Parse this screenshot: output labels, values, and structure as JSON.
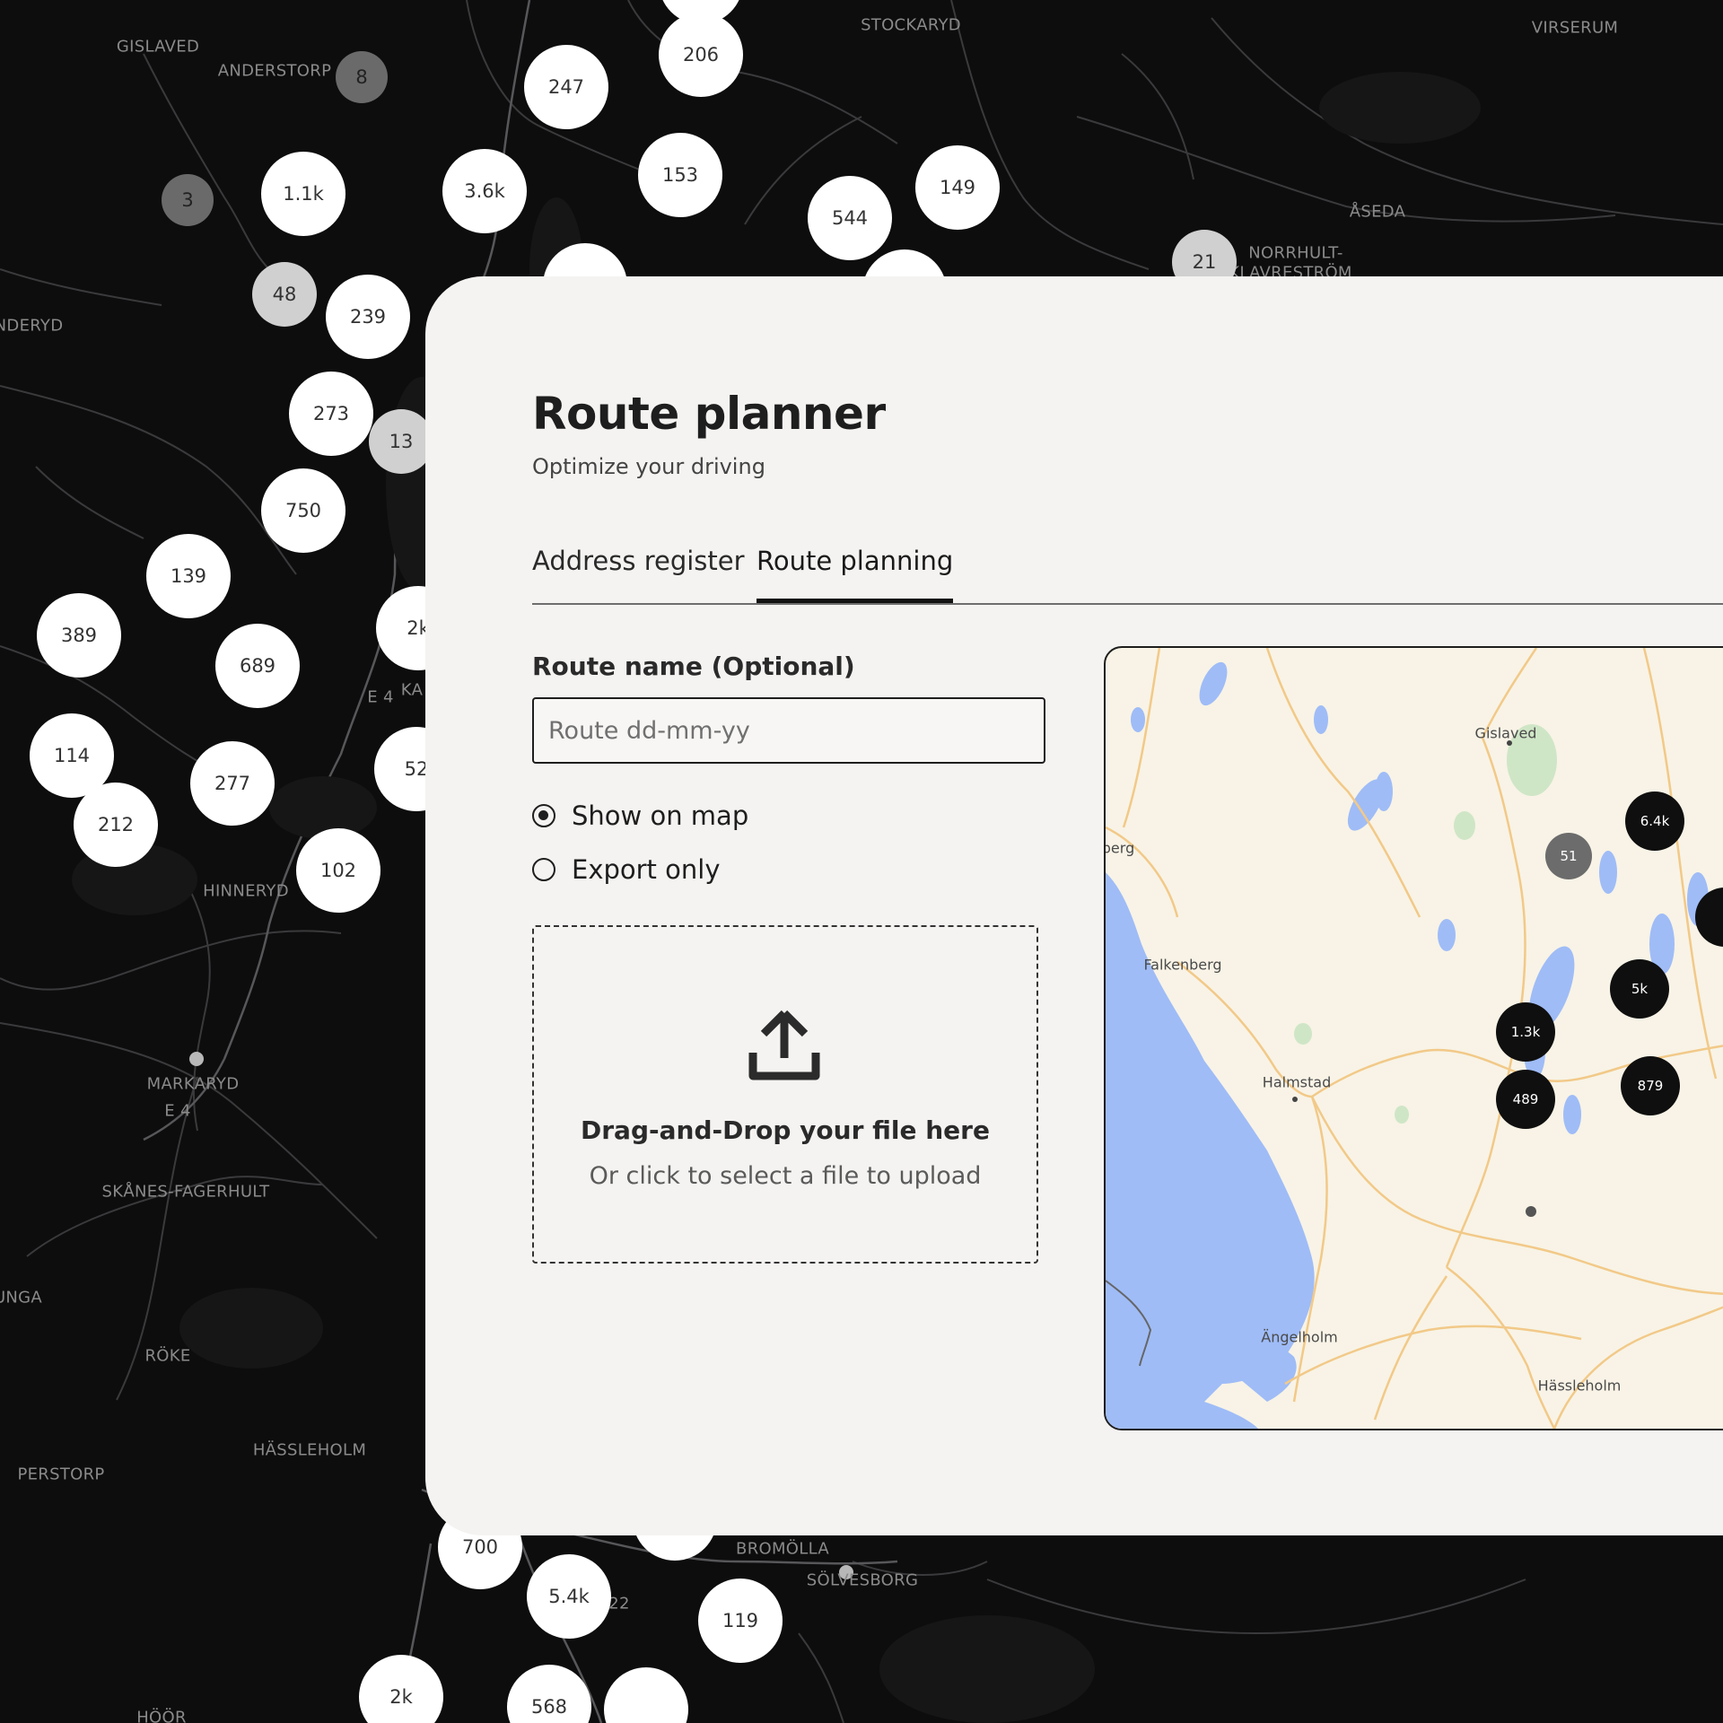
{
  "background_map": {
    "places": [
      {
        "name": "GISLAVED"
      },
      {
        "name": "ANDERSTORP"
      },
      {
        "name": "STOCKARYD"
      },
      {
        "name": "VIRSERUM"
      },
      {
        "name": "ÅSEDA"
      },
      {
        "name": "NORRHULT-"
      },
      {
        "name": "KLAVRESTRÖM"
      },
      {
        "name": "NDERYD"
      },
      {
        "name": "HINNERYD"
      },
      {
        "name": "MARKARYD"
      },
      {
        "name": "E 4"
      },
      {
        "name": "E 4"
      },
      {
        "name": "KA"
      },
      {
        "name": "SKÅNES-FAGERHULT"
      },
      {
        "name": "UNGA"
      },
      {
        "name": "RÖKE"
      },
      {
        "name": "HÄSSLEHOLM"
      },
      {
        "name": "PERSTORP"
      },
      {
        "name": "BROMÖLLA"
      },
      {
        "name": "SÖLVESBORG"
      },
      {
        "name": "HÖÖR"
      },
      {
        "name": "22"
      }
    ],
    "clusters": [
      {
        "label": "206"
      },
      {
        "label": "247"
      },
      {
        "label": "153"
      },
      {
        "label": "149"
      },
      {
        "label": "544"
      },
      {
        "label": "8"
      },
      {
        "label": "3"
      },
      {
        "label": "1.1k"
      },
      {
        "label": "3.6k"
      },
      {
        "label": "21"
      },
      {
        "label": "48"
      },
      {
        "label": "239"
      },
      {
        "label": "273"
      },
      {
        "label": "13"
      },
      {
        "label": "750"
      },
      {
        "label": "139"
      },
      {
        "label": "389"
      },
      {
        "label": "689"
      },
      {
        "label": "114"
      },
      {
        "label": "277"
      },
      {
        "label": "212"
      },
      {
        "label": "102"
      },
      {
        "label": "2k"
      },
      {
        "label": "52"
      },
      {
        "label": "700"
      },
      {
        "label": "5.4k"
      },
      {
        "label": "119"
      },
      {
        "label": "2k"
      },
      {
        "label": "568"
      }
    ]
  },
  "panel": {
    "title": "Route planner",
    "subtitle": "Optimize your driving",
    "tabs": [
      {
        "label": "Address register",
        "active": false
      },
      {
        "label": "Route planning",
        "active": true
      }
    ],
    "route_name": {
      "label": "Route name (Optional)",
      "value": "",
      "placeholder": "Route dd-mm-yy"
    },
    "display_options": [
      {
        "label": "Show on map",
        "selected": true
      },
      {
        "label": "Export only",
        "selected": false
      }
    ],
    "upload": {
      "icon": "upload-icon",
      "title": "Drag-and-Drop your file here",
      "subtitle": "Or click to select a file to upload"
    }
  },
  "mini_map": {
    "places": [
      {
        "name": "Gislaved"
      },
      {
        "name": "berg"
      },
      {
        "name": "Falkenberg"
      },
      {
        "name": "Halmstad"
      },
      {
        "name": "Ängelholm"
      },
      {
        "name": "Hässleholm"
      }
    ],
    "clusters": [
      {
        "label": "6.4k"
      },
      {
        "label": "51"
      },
      {
        "label": "5k"
      },
      {
        "label": "1.3k"
      },
      {
        "label": "489"
      },
      {
        "label": "879"
      }
    ]
  },
  "colors": {
    "map_background": "#0d0d0e",
    "panel_background": "#f4f3f1",
    "cluster_white": "#ffffff",
    "mini_map_land": "#f8f3e6",
    "mini_map_water": "#9fbcf7",
    "mini_map_cluster": "#0f0f0f"
  }
}
